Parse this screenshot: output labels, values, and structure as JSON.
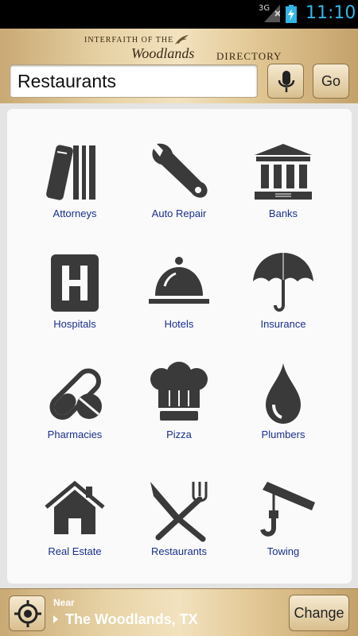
{
  "status_bar": {
    "network": "3G",
    "time": "11:10",
    "icons": [
      "signal-icon",
      "battery-charging-icon"
    ]
  },
  "header": {
    "logo": {
      "line1": "INTERFAITH OF THE",
      "line2": "Woodlands",
      "line3": "DIRECTORY"
    },
    "search": {
      "value": "Restaurants"
    },
    "mic_icon": "microphone-icon",
    "go_label": "Go"
  },
  "categories": [
    {
      "label": "Attorneys",
      "icon": "law-books-icon"
    },
    {
      "label": "Auto Repair",
      "icon": "wrench-icon"
    },
    {
      "label": "Banks",
      "icon": "bank-icon"
    },
    {
      "label": "Hospitals",
      "icon": "hospital-icon"
    },
    {
      "label": "Hotels",
      "icon": "hotel-bell-icon"
    },
    {
      "label": "Insurance",
      "icon": "umbrella-icon"
    },
    {
      "label": "Pharmacies",
      "icon": "pills-icon"
    },
    {
      "label": "Pizza",
      "icon": "chef-hat-icon"
    },
    {
      "label": "Plumbers",
      "icon": "water-drop-icon"
    },
    {
      "label": "Real Estate",
      "icon": "house-icon"
    },
    {
      "label": "Restaurants",
      "icon": "fork-knife-icon"
    },
    {
      "label": "Towing",
      "icon": "tow-hook-icon"
    }
  ],
  "footer": {
    "near_label": "Near",
    "location": "The Woodlands, TX",
    "change_label": "Change",
    "locate_icon": "crosshair-icon"
  },
  "colors": {
    "gold": "#e3c996",
    "label_blue": "#1a2f8f",
    "icon_dark": "#3a3a3a",
    "status_blue": "#33b5e5"
  }
}
